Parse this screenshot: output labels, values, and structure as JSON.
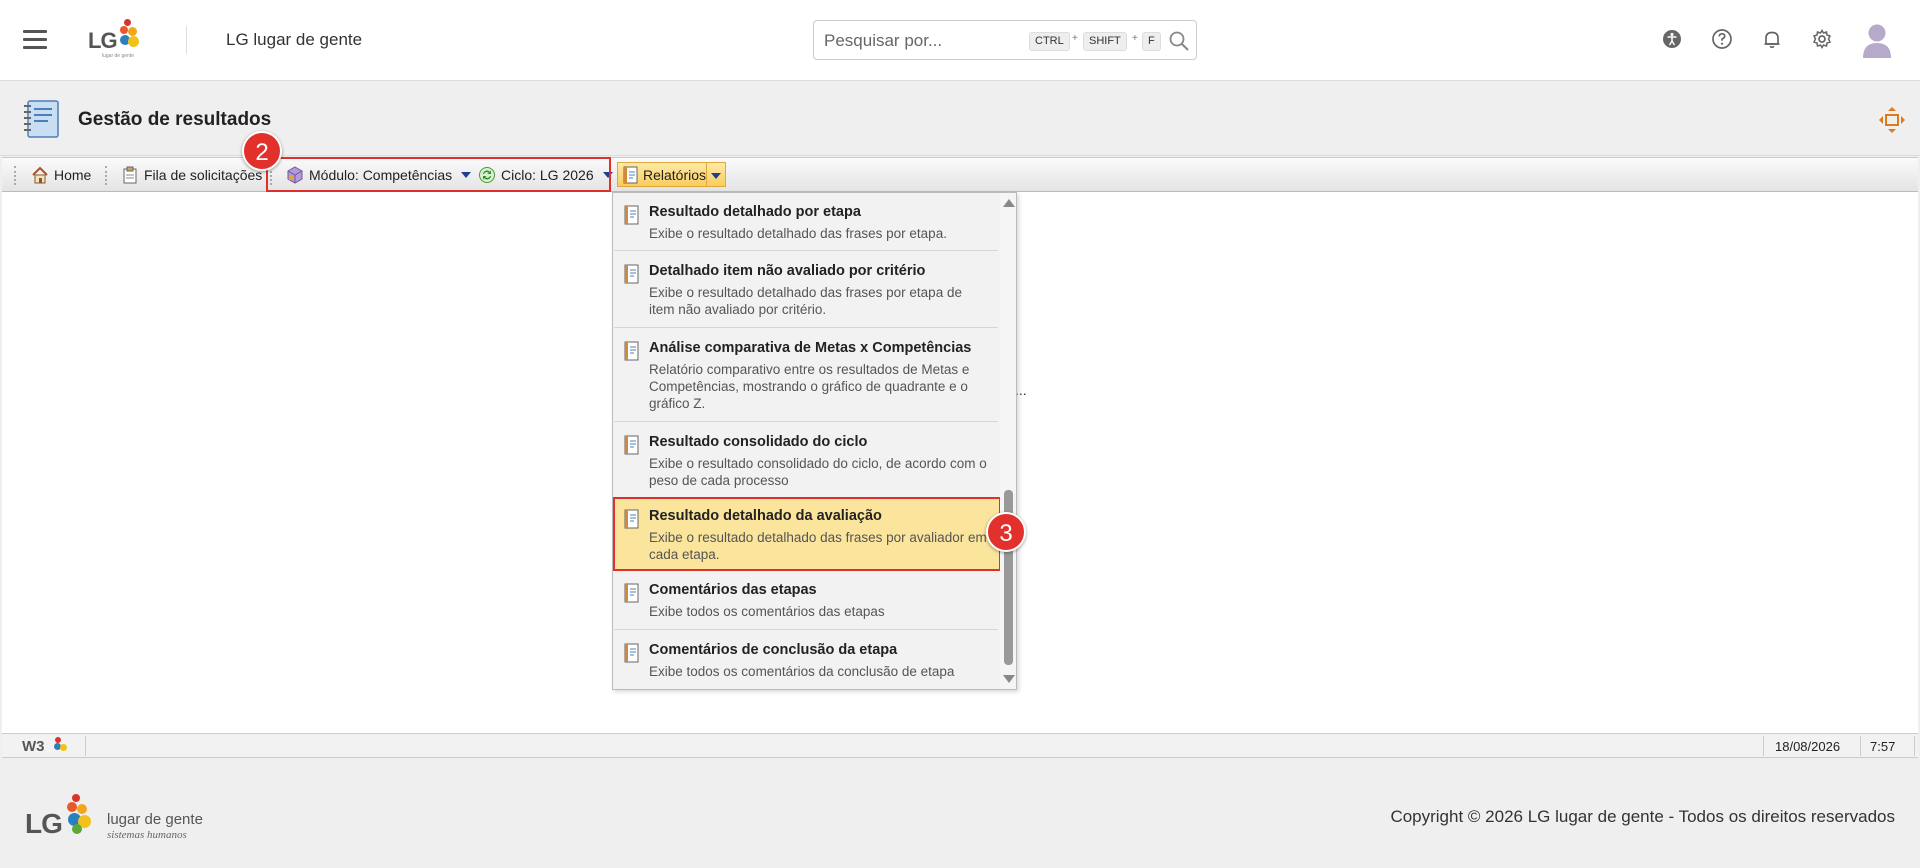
{
  "header": {
    "app_title": "LG lugar de gente",
    "logo_text": "LG",
    "logo_sub": "lugar de gente",
    "search_placeholder": "Pesquisar por...",
    "shortcut": {
      "k1": "CTRL",
      "k2": "SHIFT",
      "k3": "F",
      "sep": "+"
    }
  },
  "page": {
    "title": "Gestão de resultados"
  },
  "toolbar": {
    "home": "Home",
    "queue": "Fila de solicitações",
    "module": "Módulo: Competências",
    "cycle": "Ciclo: LG 2026",
    "reports": "Relatórios"
  },
  "badges": {
    "b2": "2",
    "b3": "3"
  },
  "content": {
    "ellipsis": "..."
  },
  "menu": {
    "items": [
      {
        "title": "Resultado detalhado por etapa",
        "desc": "Exibe o resultado detalhado das frases por etapa."
      },
      {
        "title": "Detalhado item não avaliado por critério",
        "desc": "Exibe o resultado detalhado das frases por etapa de item não avaliado por critério."
      },
      {
        "title": "Análise comparativa de Metas x Competências",
        "desc": "Relatório comparativo entre os resultados de Metas e Competências, mostrando o gráfico de quadrante e o gráfico Z."
      },
      {
        "title": "Resultado consolidado do ciclo",
        "desc": "Exibe o resultado consolidado do ciclo, de acordo com o peso de cada processo"
      },
      {
        "title": "Resultado detalhado da avaliação",
        "desc": "Exibe o resultado detalhado das frases por avaliador em cada etapa."
      },
      {
        "title": "Comentários das etapas",
        "desc": "Exibe todos os comentários das etapas"
      },
      {
        "title": "Comentários de conclusão da etapa",
        "desc": "Exibe todos os comentários da conclusão de etapa"
      }
    ]
  },
  "statusbar": {
    "logo": "W3",
    "date": "18/08/2026",
    "time": "7:57"
  },
  "footer": {
    "logo_text": "LG",
    "brand": "lugar de gente",
    "tagline": "sistemas humanos",
    "copyright": "Copyright © 2026 LG lugar de gente - Todos os direitos reservados"
  },
  "colors": {
    "accent_red": "#e2312d",
    "highlight_yellow": "#fbe49c",
    "toolbar_caret": "#1f3f8f"
  }
}
